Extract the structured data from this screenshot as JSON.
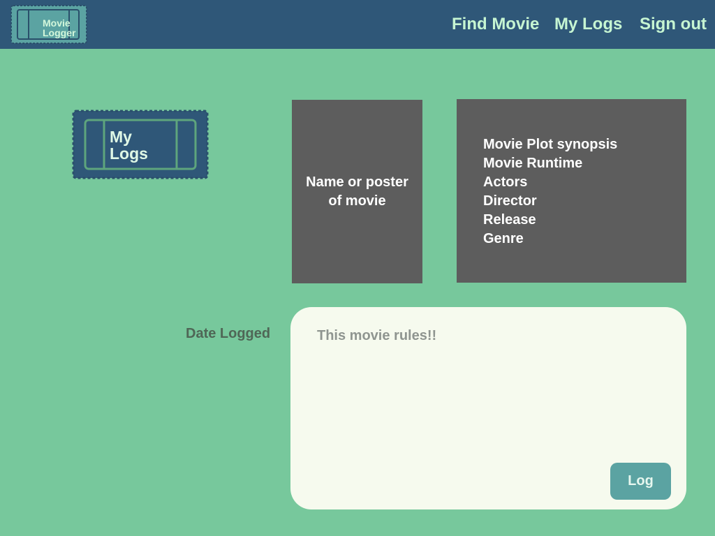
{
  "header": {
    "brand_text": "Movie\nLogger",
    "nav": {
      "find_movie": "Find Movie",
      "my_logs": "My Logs",
      "sign_out": "Sign out"
    }
  },
  "sidebar": {
    "ticket_label": "My\nLogs"
  },
  "movie": {
    "poster_placeholder": "Name or poster\nof movie",
    "details": [
      "Movie Plot synopsis",
      "Movie Runtime",
      "Actors",
      "Director",
      "Release",
      "Genre"
    ]
  },
  "log_form": {
    "date_label": "Date Logged",
    "review_placeholder": "This movie rules!!",
    "submit_label": "Log"
  },
  "colors": {
    "page_background": "#77c89c",
    "topbar": "#2f5778",
    "nav_text": "#c6f5d2",
    "panel_grey": "#5d5d5d",
    "log_box": "#f6faee",
    "log_button": "#5ba3a2",
    "ticket_blue": "#2f5778",
    "ticket_teal": "#5ba3a2"
  }
}
